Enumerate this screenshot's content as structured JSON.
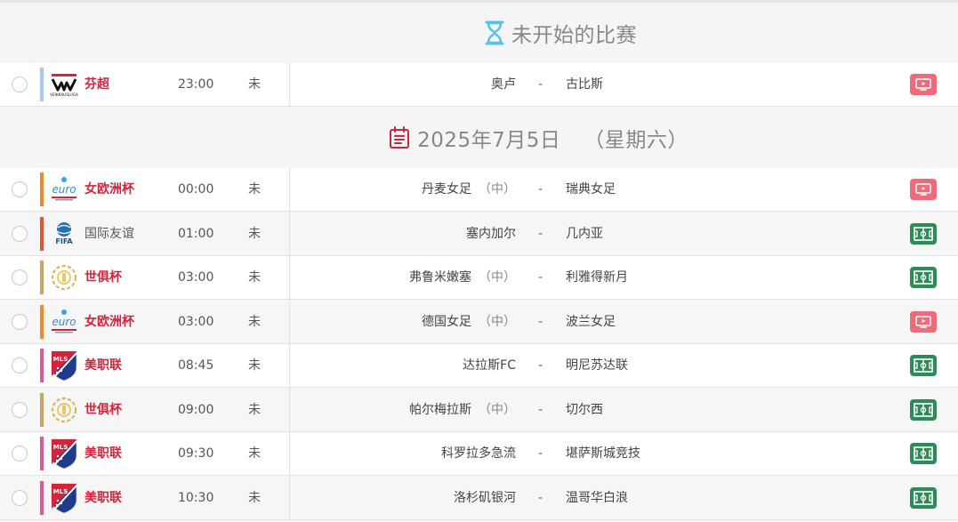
{
  "sections": {
    "upcoming": {
      "title": "未开始的比赛"
    },
    "date": {
      "title": "2025年7月5日",
      "weekday": "（星期六）"
    }
  },
  "colors": {
    "red": "#d0253a",
    "tv": "#ee6b7a",
    "field": "#2f8a5a",
    "bar_blue": "#a9c8ef",
    "bar_orange": "#f08a24",
    "bar_red": "#e5542e",
    "bar_gold": "#c8a560",
    "bar_pink": "#e0579a"
  },
  "matches": [
    {
      "league": "芬超",
      "league_style": "red",
      "logo": "veikkausliiga-logo",
      "logo_text": "VEIKKAUSLIIGA",
      "bar": "#a9c8ef",
      "time": "23:00",
      "status": "未",
      "home": "奥卢",
      "neutral": "",
      "sep": "-",
      "away": "古比斯",
      "media": "tv-icon"
    },
    {
      "league": "女欧洲杯",
      "league_style": "red",
      "logo": "womens-euro-logo",
      "logo_text": "euro",
      "bar": "#f08a24",
      "time": "00:00",
      "status": "未",
      "home": "丹麦女足",
      "neutral": "（中）",
      "sep": "-",
      "away": "瑞典女足",
      "media": "tv-icon"
    },
    {
      "league": "国际友谊",
      "league_style": "plain",
      "logo": "fifa-logo",
      "logo_text": "FIFA",
      "bar": "#e5542e",
      "time": "01:00",
      "status": "未",
      "home": "塞内加尔",
      "neutral": "",
      "sep": "-",
      "away": "几内亚",
      "media": "field-icon"
    },
    {
      "league": "世俱杯",
      "league_style": "red",
      "logo": "club-world-cup-logo",
      "logo_text": "",
      "bar": "#c8a560",
      "time": "03:00",
      "status": "未",
      "home": "弗鲁米嫩塞",
      "neutral": "（中）",
      "sep": "-",
      "away": "利雅得新月",
      "media": "field-icon"
    },
    {
      "league": "女欧洲杯",
      "league_style": "red",
      "logo": "womens-euro-logo",
      "logo_text": "euro",
      "bar": "#f08a24",
      "time": "03:00",
      "status": "未",
      "home": "德国女足",
      "neutral": "（中）",
      "sep": "-",
      "away": "波兰女足",
      "media": "tv-icon"
    },
    {
      "league": "美职联",
      "league_style": "red",
      "logo": "mls-logo",
      "logo_text": "MLS",
      "bar": "#e0579a",
      "time": "08:45",
      "status": "未",
      "home": "达拉斯FC",
      "neutral": "",
      "sep": "-",
      "away": "明尼苏达联",
      "media": "field-icon"
    },
    {
      "league": "世俱杯",
      "league_style": "red",
      "logo": "club-world-cup-logo",
      "logo_text": "",
      "bar": "#c8a560",
      "time": "09:00",
      "status": "未",
      "home": "帕尔梅拉斯",
      "neutral": "（中）",
      "sep": "-",
      "away": "切尔西",
      "media": "field-icon"
    },
    {
      "league": "美职联",
      "league_style": "red",
      "logo": "mls-logo",
      "logo_text": "MLS",
      "bar": "#e0579a",
      "time": "09:30",
      "status": "未",
      "home": "科罗拉多急流",
      "neutral": "",
      "sep": "-",
      "away": "堪萨斯城竞技",
      "media": "field-icon"
    },
    {
      "league": "美职联",
      "league_style": "red",
      "logo": "mls-logo",
      "logo_text": "MLS",
      "bar": "#e0579a",
      "time": "10:30",
      "status": "未",
      "home": "洛杉矶银河",
      "neutral": "",
      "sep": "-",
      "away": "温哥华白浪",
      "media": "field-icon"
    }
  ]
}
